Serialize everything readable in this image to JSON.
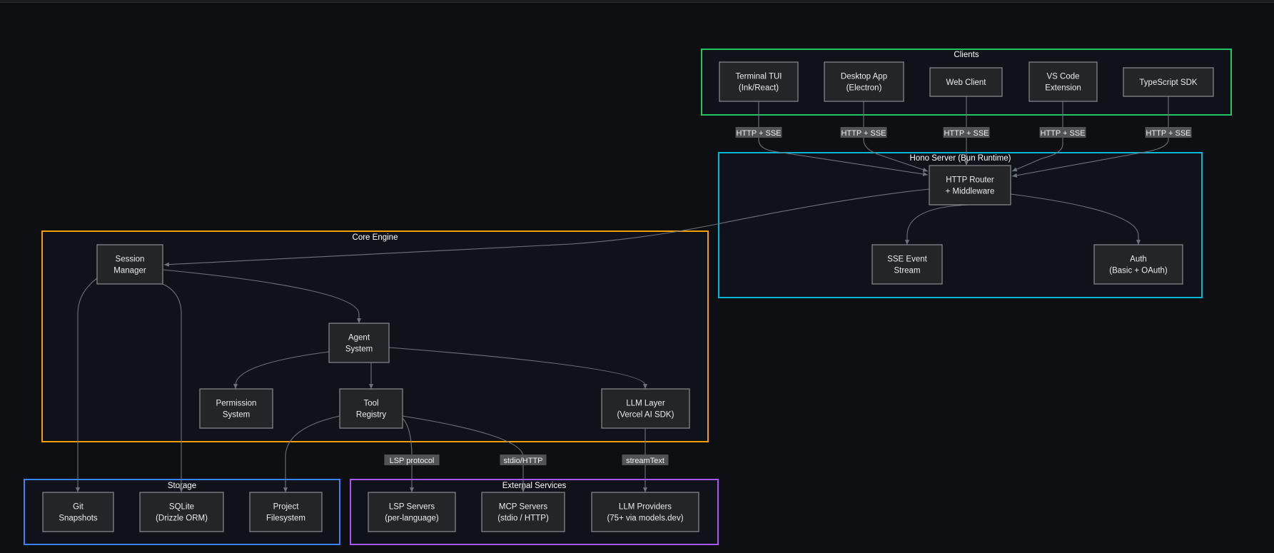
{
  "colors": {
    "background": "#0d0f12",
    "clients": "#22c55e",
    "server": "#06b6d4",
    "core": "#f59e0b",
    "storage": "#3b82f6",
    "external": "#a855f7",
    "node_fill": "#232528",
    "node_stroke": "#8a8d92",
    "edge": "#6e737b"
  },
  "groups": {
    "clients": "Clients",
    "server": "Hono Server (Bun Runtime)",
    "core": "Core Engine",
    "storage": "Storage",
    "external": "External Services"
  },
  "nodes": {
    "tui": [
      "Terminal TUI",
      "(Ink/React)"
    ],
    "desktop": [
      "Desktop App",
      "(Electron)"
    ],
    "web": [
      "Web Client"
    ],
    "vscode": [
      "VS Code",
      "Extension"
    ],
    "sdk": [
      "TypeScript SDK"
    ],
    "router": [
      "HTTP Router",
      "+ Middleware"
    ],
    "sse": [
      "SSE Event",
      "Stream"
    ],
    "auth": [
      "Auth",
      "(Basic + OAuth)"
    ],
    "session": [
      "Session",
      "Manager"
    ],
    "agent": [
      "Agent",
      "System"
    ],
    "permission": [
      "Permission",
      "System"
    ],
    "tool": [
      "Tool",
      "Registry"
    ],
    "llm": [
      "LLM Layer",
      "(Vercel AI SDK)"
    ],
    "git": [
      "Git",
      "Snapshots"
    ],
    "sqlite": [
      "SQLite",
      "(Drizzle ORM)"
    ],
    "fs": [
      "Project",
      "Filesystem"
    ],
    "lsp": [
      "LSP Servers",
      "(per-language)"
    ],
    "mcp": [
      "MCP Servers",
      "(stdio / HTTP)"
    ],
    "providers": [
      "LLM Providers",
      "(75+ via models.dev)"
    ]
  },
  "edges": {
    "tui_router": "HTTP + SSE",
    "desktop_router": "HTTP + SSE",
    "web_router": "HTTP + SSE",
    "vscode_router": "HTTP + SSE",
    "sdk_router": "HTTP + SSE",
    "tool_lsp": "LSP protocol",
    "tool_mcp": "stdio/HTTP",
    "llm_providers": "streamText"
  }
}
